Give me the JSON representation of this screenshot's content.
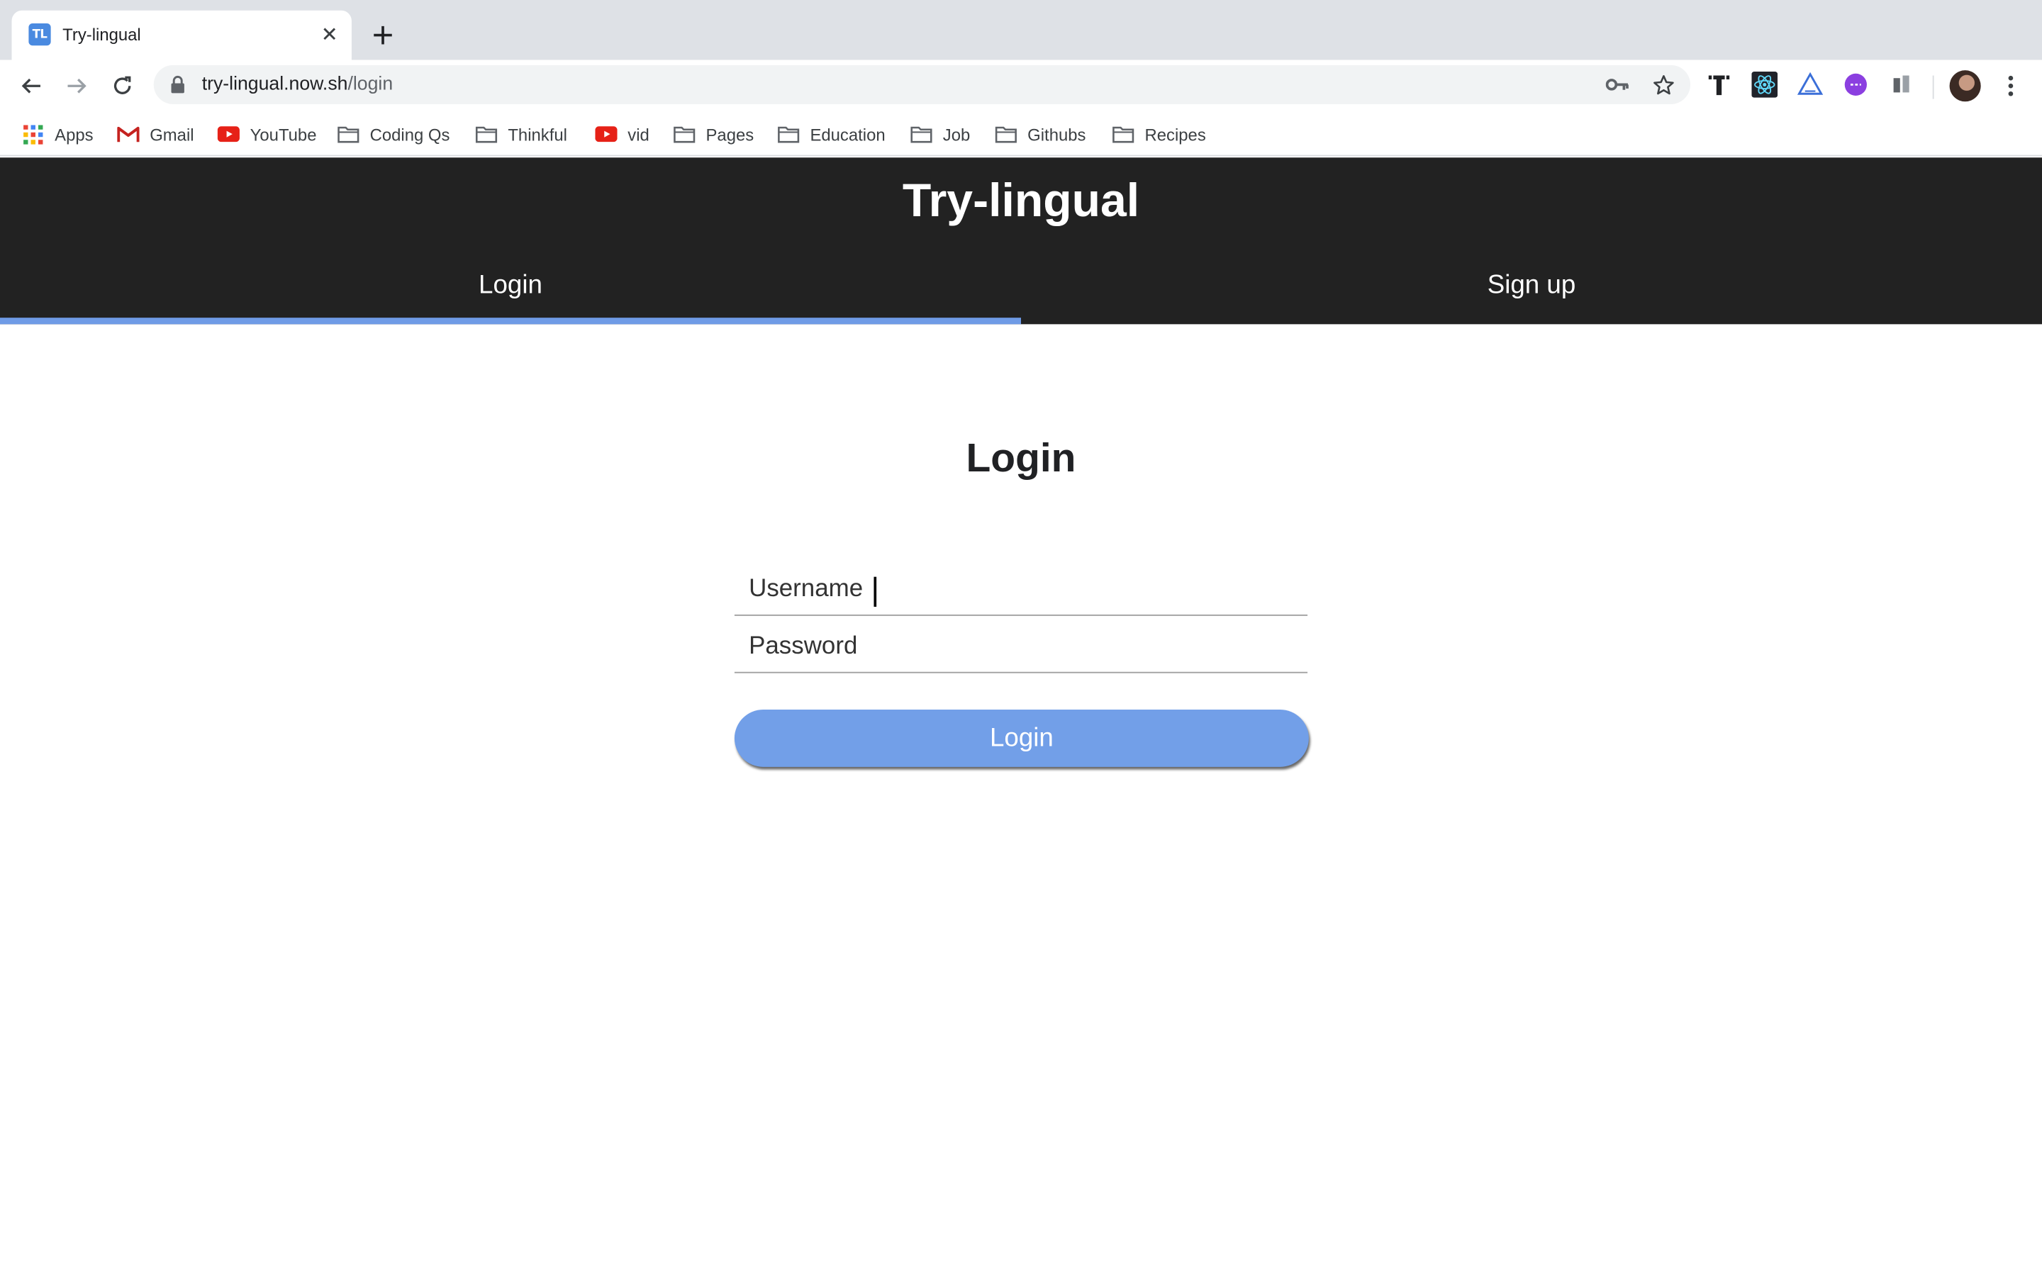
{
  "browser": {
    "tab": {
      "favicon_text": "TL",
      "title": "Try-lingual"
    },
    "url": {
      "host": "try-lingual.now.sh",
      "path": "/login"
    },
    "bookmarks": [
      {
        "label": "Apps",
        "icon": "apps-grid-icon"
      },
      {
        "label": "Gmail",
        "icon": "gmail-icon"
      },
      {
        "label": "YouTube",
        "icon": "youtube-icon"
      },
      {
        "label": "Coding Qs",
        "icon": "folder-icon"
      },
      {
        "label": "Thinkful",
        "icon": "folder-icon"
      },
      {
        "label": "vid",
        "icon": "youtube-icon"
      },
      {
        "label": "Pages",
        "icon": "folder-icon"
      },
      {
        "label": "Education",
        "icon": "folder-icon"
      },
      {
        "label": "Job",
        "icon": "folder-icon"
      },
      {
        "label": "Githubs",
        "icon": "folder-icon"
      },
      {
        "label": "Recipes",
        "icon": "folder-icon"
      }
    ]
  },
  "app": {
    "brand": "Try-lingual",
    "nav": {
      "login": "Login",
      "signup": "Sign up",
      "active": "login"
    },
    "login": {
      "title": "Login",
      "username_placeholder": "Username",
      "username_value": "",
      "password_placeholder": "Password",
      "password_value": "",
      "submit_label": "Login"
    }
  },
  "colors": {
    "header_bg": "#222222",
    "accent": "#729fe8",
    "active_underline": "#6f9be6"
  }
}
